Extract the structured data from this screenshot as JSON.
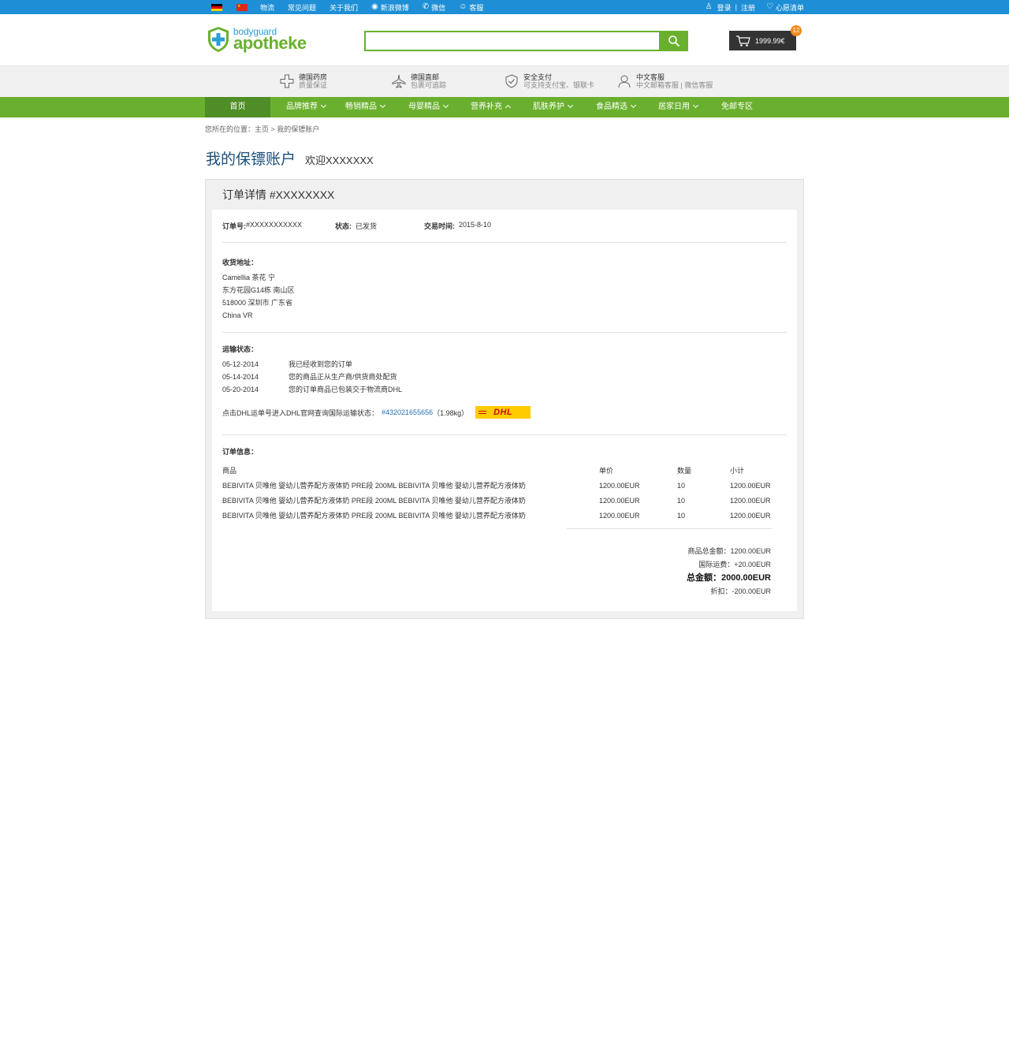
{
  "topbar": {
    "links": [
      "物流",
      "常见问题",
      "关于我们",
      "新浪微博",
      "微信",
      "客服"
    ],
    "login": "登录",
    "register": "注册",
    "wishlist": "心愿清单"
  },
  "header": {
    "logo_small": "bodyguard",
    "logo_big": "apotheke",
    "search_placeholder": "",
    "cart_total": "1999.99€",
    "cart_count": "12"
  },
  "features": [
    {
      "title": "德国药房",
      "sub": "质量保证",
      "icon": "cross-icon"
    },
    {
      "title": "德国直邮",
      "sub": "包裹可追踪",
      "icon": "plane-icon"
    },
    {
      "title": "安全支付",
      "sub": "可支持支付宝、银联卡",
      "icon": "shield-check-icon"
    },
    {
      "title": "中文客服",
      "sub": "中文邮箱客服 | 微信客服",
      "icon": "user-icon"
    }
  ],
  "nav": {
    "home": "首页",
    "items": [
      "品牌推荐",
      "畅销精品",
      "母婴精品",
      "营养补充",
      "肌肤养护",
      "食品精选",
      "居家日用",
      "免邮专区"
    ]
  },
  "breadcrumb": "您所在的位置：主页 > 我的保镖账户",
  "page": {
    "title": "我的保镖账户",
    "welcome": "欢迎XXXXXXX"
  },
  "panel": {
    "header": "订单详情 #XXXXXXXX",
    "order_no_label": "订单号:",
    "order_no": "#XXXXXXXXXXX",
    "status_label": "状态:",
    "status": "已发货",
    "time_label": "交易时间:",
    "time": "2015-8-10",
    "address_label": "收货地址：",
    "address": [
      "Camellia 茶花 宁",
      "东方花园G14栋 南山区",
      "518000 深圳市 广东省",
      "China VR"
    ],
    "shipping_label": "运输状态：",
    "shipping": [
      {
        "date": "05-12-2014",
        "text": "我已经收到您的订单"
      },
      {
        "date": "05-14-2014",
        "text": "您的商品正从生产商/供货商处配货"
      },
      {
        "date": "05-20-2014",
        "text": "您的订单商品已包装交于物流商DHL"
      }
    ],
    "dhl_text": "点击DHL运单号进入DHL官网查询国际运输状态：",
    "dhl_number": "#432021655656",
    "dhl_weight": "（1.98kg）",
    "dhl_logo": "DHL",
    "order_info_label": "订单信息：",
    "columns": [
      "商品",
      "单价",
      "数量",
      "小计"
    ],
    "items": [
      {
        "name": "BEBIVITA 贝唯他  婴幼儿营养配方液体奶  PRE段  200ML BEBIVITA  贝唯他  婴幼儿营养配方液体奶",
        "price": "1200.00EUR",
        "qty": "10",
        "subtotal": "1200.00EUR"
      },
      {
        "name": "BEBIVITA 贝唯他  婴幼儿营养配方液体奶  PRE段  200ML BEBIVITA  贝唯他  婴幼儿营养配方液体奶",
        "price": "1200.00EUR",
        "qty": "10",
        "subtotal": "1200.00EUR"
      },
      {
        "name": "BEBIVITA 贝唯他  婴幼儿营养配方液体奶  PRE段  200ML BEBIVITA  贝唯他  婴幼儿营养配方液体奶",
        "price": "1200.00EUR",
        "qty": "10",
        "subtotal": "1200.00EUR"
      }
    ],
    "totals": {
      "goods": "商品总金额：1200.00EUR",
      "shipping": "国际运费：+20.00EUR",
      "total": "总金额：2000.00EUR",
      "discount": "折扣：-200.00EUR"
    }
  },
  "colors": {
    "topbar": "#1e8fd6",
    "green": "#6ab02e",
    "green_dark": "#4f8e26",
    "link": "#1f6fb5",
    "title": "#1a4f7a"
  }
}
